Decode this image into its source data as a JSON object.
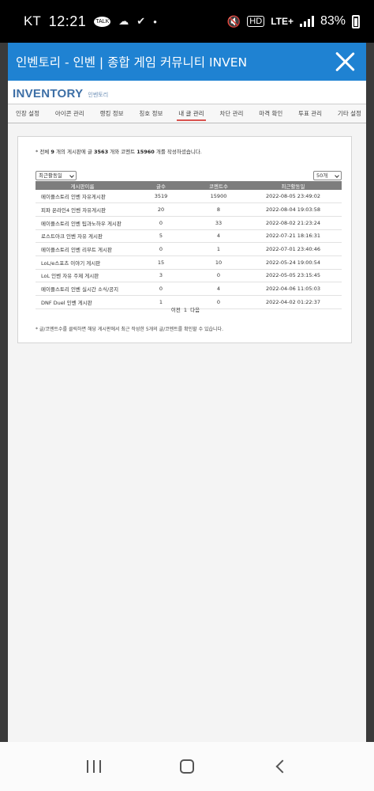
{
  "status_bar": {
    "carrier": "KT",
    "time": "12:21",
    "talk_label": "TALK",
    "dot": "•",
    "hd_label": "HD",
    "network": "LTE+",
    "battery": "83%"
  },
  "dialog": {
    "title": "인벤토리 - 인벤 | 종합 게임 커뮤니티 INVEN"
  },
  "logo": {
    "main": "INVENTORY",
    "sub": "인벤토리"
  },
  "tabs": [
    {
      "label": "인장 설정"
    },
    {
      "label": "아이콘 관리"
    },
    {
      "label": "랭킹 정보"
    },
    {
      "label": "칭호 정보"
    },
    {
      "label": "내 글 관리"
    },
    {
      "label": "차단 관리"
    },
    {
      "label": "마격 확인"
    },
    {
      "label": "투표 관리"
    },
    {
      "label": "기타 설정"
    }
  ],
  "summary": {
    "prefix": "* 전체 ",
    "boards": "9",
    "mid1": " 개의 게시판에 글 ",
    "posts": "3563",
    "mid2": " 개와 코멘트 ",
    "comments": "15960",
    "suffix": " 개를 작성하셨습니다."
  },
  "controls": {
    "sort_selected": "최근활동일",
    "count_selected": "50개"
  },
  "table": {
    "headers": [
      "게시판이름",
      "글수",
      "코멘트수",
      "최근활동일"
    ],
    "rows": [
      {
        "board": "메이플스토리 인벤 자유게시판",
        "posts": "3519",
        "comments": "15900",
        "date": "2022-08-05 23:49:02"
      },
      {
        "board": "피파 온라인4 인벤 자유게시판",
        "posts": "20",
        "comments": "8",
        "date": "2022-08-04 19:03:58"
      },
      {
        "board": "메이플스토리 인벤 팁과노하우 게시판",
        "posts": "0",
        "comments": "33",
        "date": "2022-08-02 21:23:24"
      },
      {
        "board": "로스트아크 인벤 자유 게시판",
        "posts": "5",
        "comments": "4",
        "date": "2022-07-21 18:16:31"
      },
      {
        "board": "메이플스토리 인벤 리부트 게시판",
        "posts": "0",
        "comments": "1",
        "date": "2022-07-01 23:40:46"
      },
      {
        "board": "LoL/e스포츠 이야기 게시판",
        "posts": "15",
        "comments": "10",
        "date": "2022-05-24 19:00:54"
      },
      {
        "board": "LoL 인벤 자유 주제 게시판",
        "posts": "3",
        "comments": "0",
        "date": "2022-05-05 23:15:45"
      },
      {
        "board": "메이플스토리 인벤 실시간 소식/공지",
        "posts": "0",
        "comments": "4",
        "date": "2022-04-06 11:05:03"
      },
      {
        "board": "DNF Duel 인벤 게시판",
        "posts": "1",
        "comments": "0",
        "date": "2022-04-02 01:22:37"
      }
    ]
  },
  "pager": {
    "prev": "이전",
    "page": "1",
    "next": "다음"
  },
  "footnote": "* 글/코멘트수를 클릭하면 해당 게시판에서 최근 작성한 5개의 글/코멘트를 확인할 수 있습니다.",
  "colors": {
    "titlebar": "#1f82d2",
    "active_tab_underline": "#d9534f",
    "table_header": "#7d7d7d"
  },
  "nav_icons": [
    "recent-apps-icon",
    "home-icon",
    "back-icon"
  ]
}
